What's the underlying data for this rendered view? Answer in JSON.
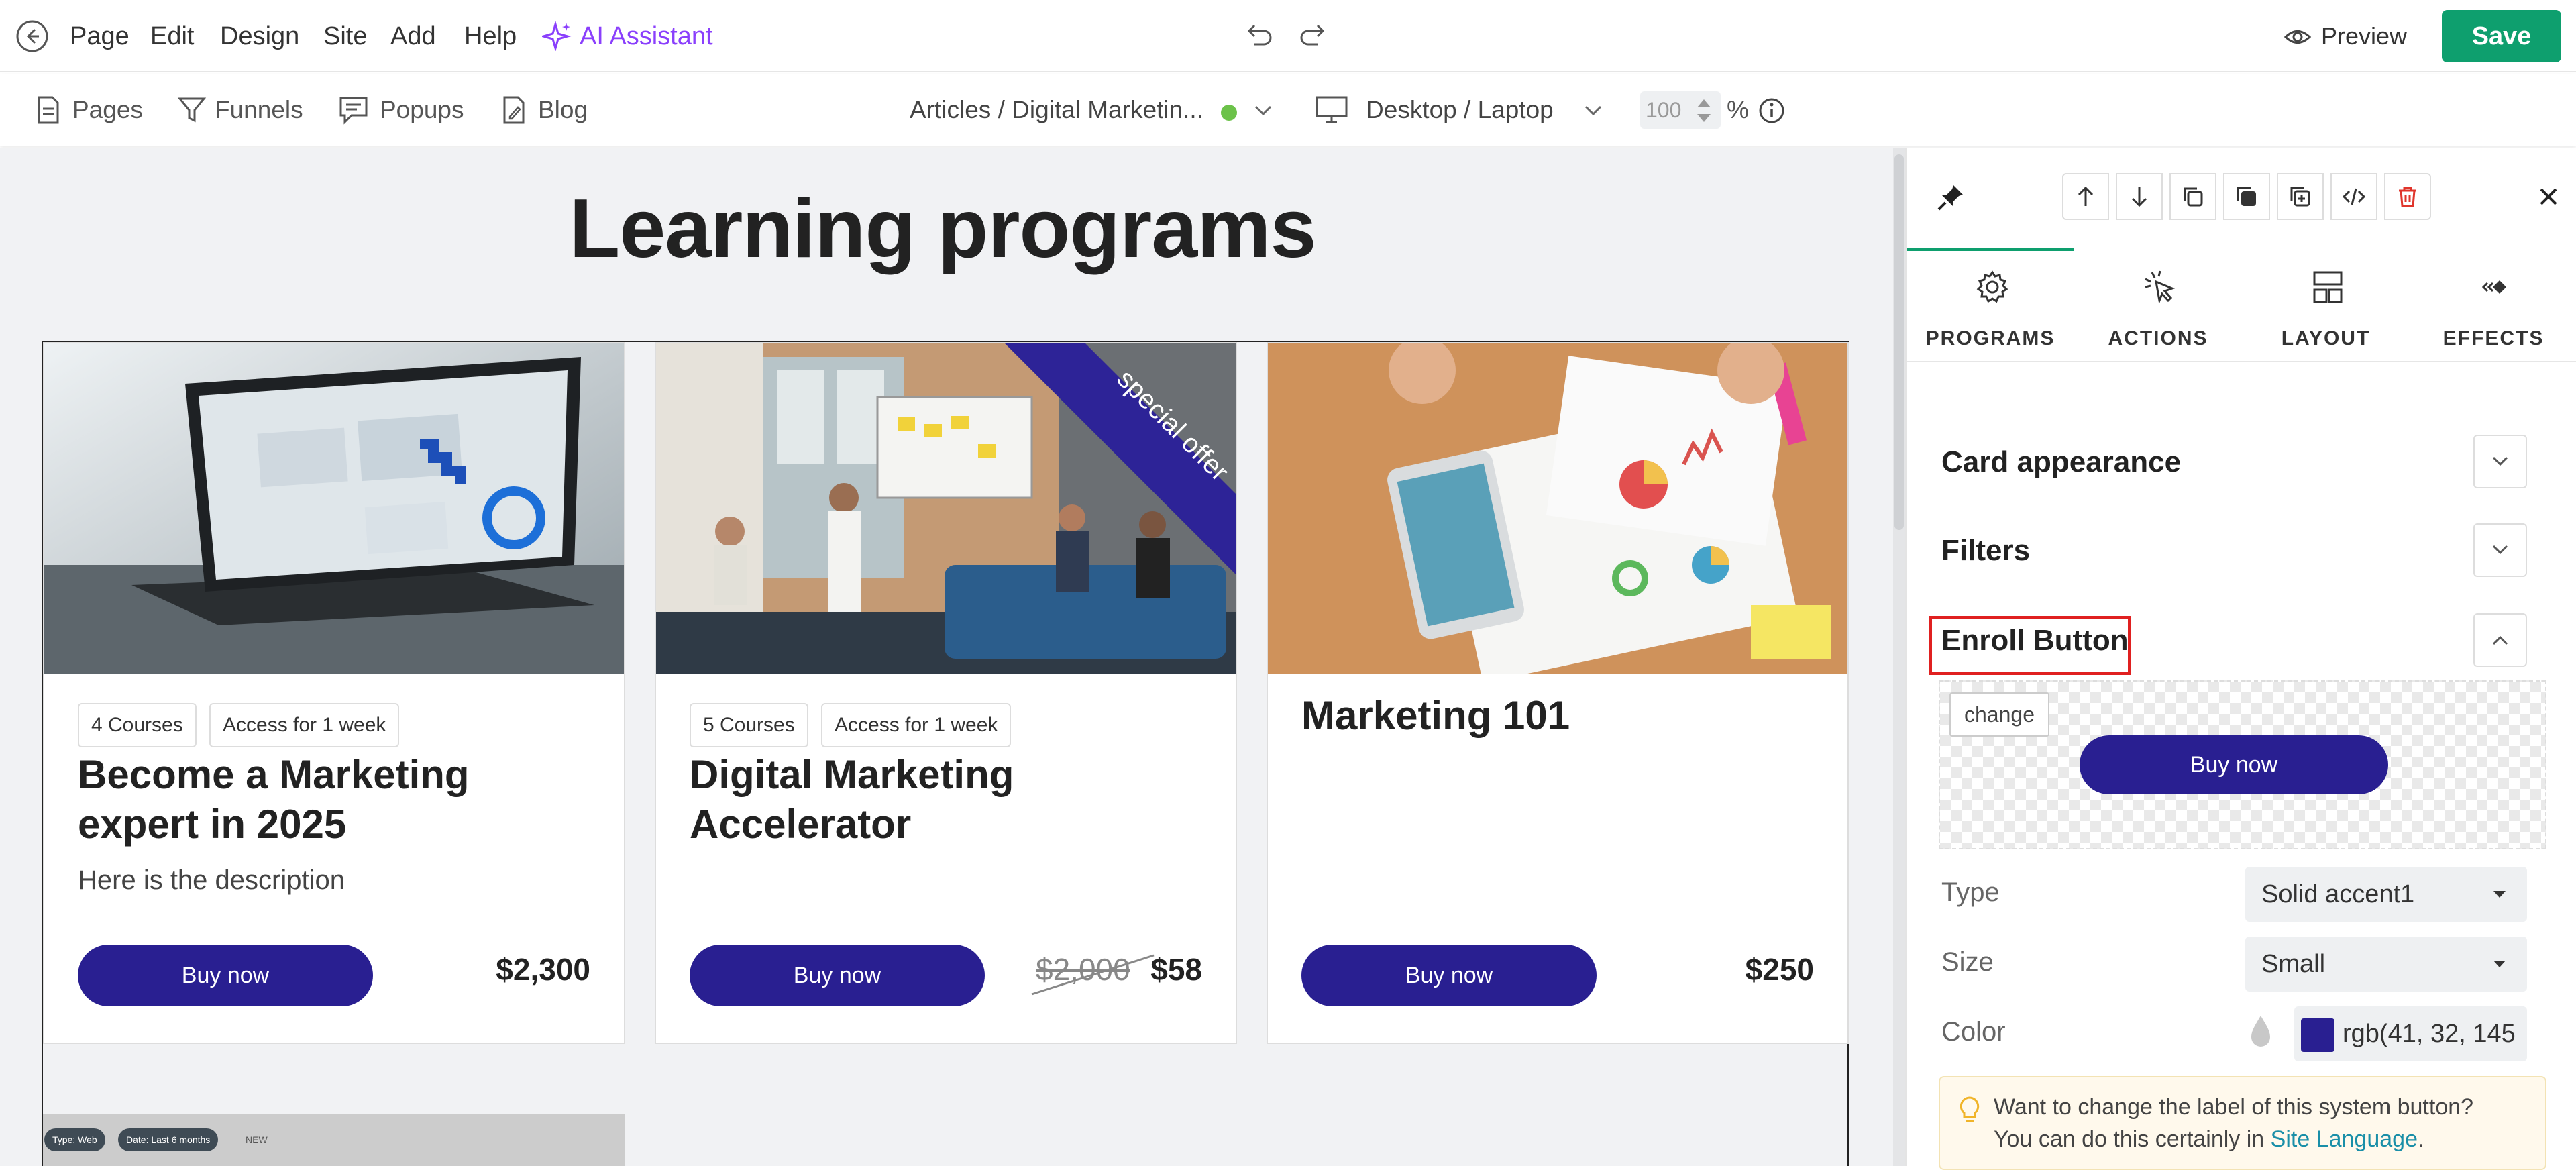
{
  "topbar": {
    "menu": [
      "Page",
      "Edit",
      "Design",
      "Site",
      "Add",
      "Help"
    ],
    "ai_assistant": "AI Assistant",
    "preview": "Preview",
    "save": "Save"
  },
  "subbar": {
    "nav": [
      "Pages",
      "Funnels",
      "Popups",
      "Blog"
    ],
    "page_selector": "Articles / Digital Marketin...",
    "device": "Desktop / Laptop",
    "zoom": "100",
    "zoom_unit": "%"
  },
  "canvas": {
    "heading": "Learning programs",
    "cards": [
      {
        "tags": [
          "4 Courses",
          "Access for 1 week"
        ],
        "title": "Become a Marketing expert in 2025",
        "description": "Here is the description",
        "button": "Buy now",
        "price": "$2,300",
        "old_price": ""
      },
      {
        "tags": [
          "5 Courses",
          "Access for 1 week"
        ],
        "title": "Digital Marketing Accelerator",
        "description": "",
        "button": "Buy now",
        "price": "$58",
        "old_price": "$2,000",
        "ribbon": "special offer"
      },
      {
        "tags": [],
        "title": "Marketing 101",
        "description": "",
        "button": "Buy now",
        "price": "$250",
        "old_price": ""
      }
    ],
    "partial_card_chips": [
      "Type: Web",
      "Date: Last 6 months",
      "NEW"
    ]
  },
  "panel": {
    "tabs": [
      "PROGRAMS",
      "ACTIONS",
      "LAYOUT",
      "EFFECTS"
    ],
    "sections": [
      "Card appearance",
      "Filters",
      "Enroll Button"
    ],
    "preview_change": "change",
    "preview_button": "Buy now",
    "rows": [
      {
        "label": "Type",
        "value": "Solid accent1"
      },
      {
        "label": "Size",
        "value": "Small"
      },
      {
        "label": "Color",
        "value": "rgb(41, 32, 145"
      }
    ],
    "info_line1": "Want to change the label of this system button?",
    "info_line2": "You can do this certainly in",
    "info_link": "Site Language",
    "info_end": "."
  },
  "colors": {
    "accent": "#291f91",
    "save": "#0e9f6e",
    "ai": "#8a3ffc",
    "ribbon": "#2d2397",
    "highlight": "#e02020"
  }
}
